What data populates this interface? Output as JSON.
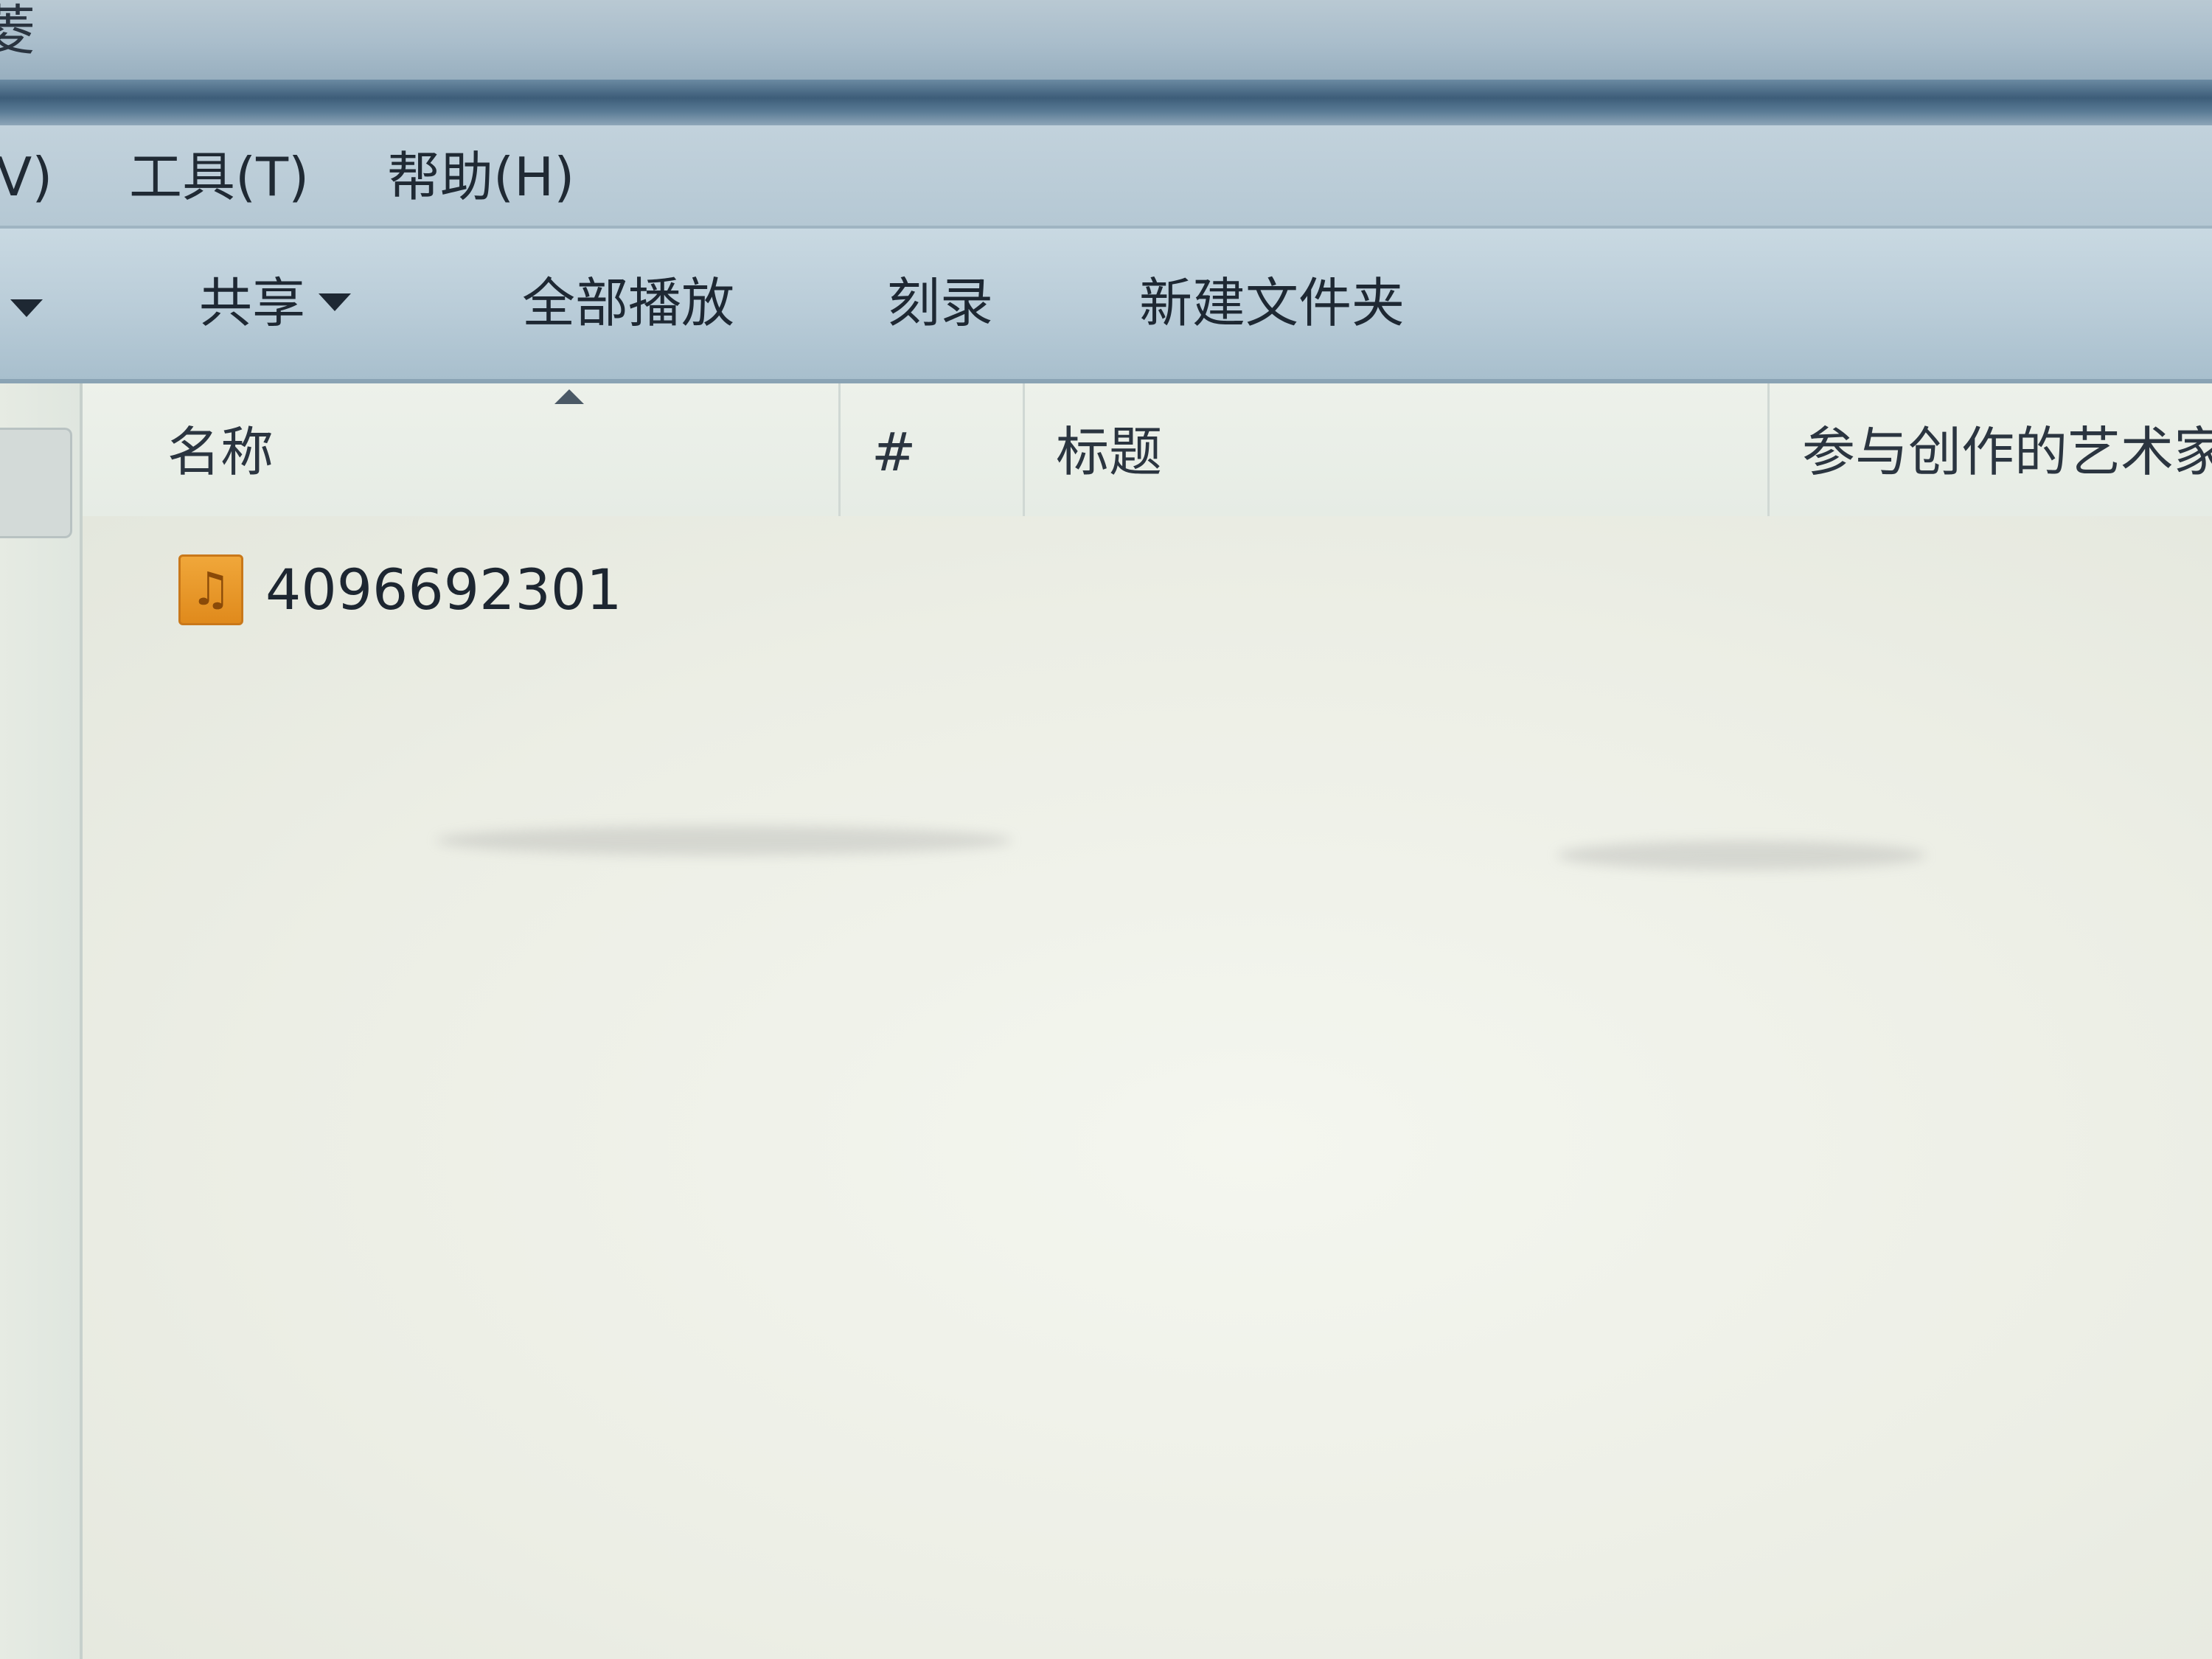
{
  "window": {
    "title_fragment": "菱"
  },
  "menu": {
    "items": [
      {
        "label": "V)"
      },
      {
        "label": "工具(T)"
      },
      {
        "label": "帮助(H)"
      }
    ]
  },
  "toolbar": {
    "share_label": "共享",
    "play_all_label": "全部播放",
    "burn_label": "刻录",
    "new_folder_label": "新建文件夹"
  },
  "columns": {
    "name": "名称",
    "track_number": "#",
    "title": "标题",
    "contributing_artists": "参与创作的艺术家"
  },
  "files": [
    {
      "name": "4096692301",
      "icon": "music-file-icon"
    }
  ],
  "colors": {
    "toolbar": "#b9ccd8",
    "list_background": "#eef1e8",
    "music_icon": "#f0a73a"
  }
}
